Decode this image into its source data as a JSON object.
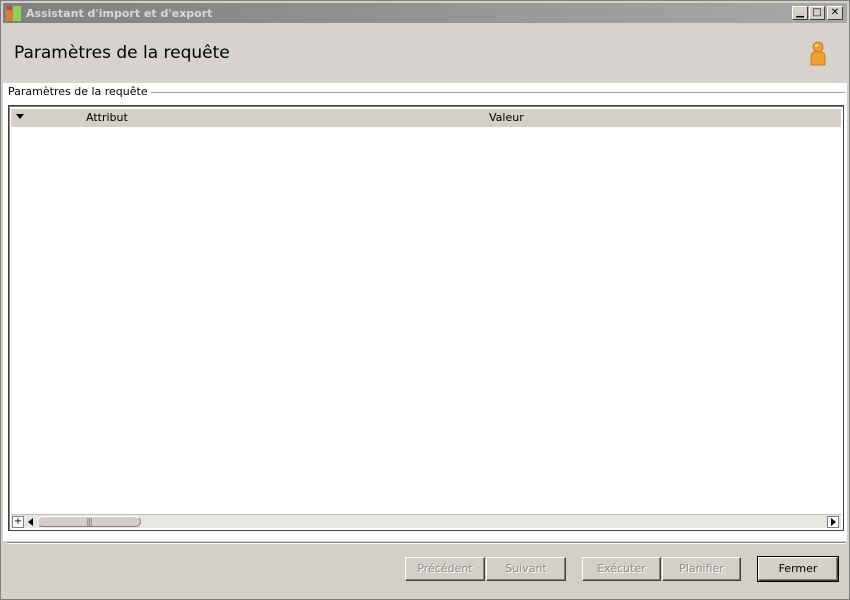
{
  "window": {
    "title": "Assistant d'import et d'export",
    "controls": {
      "minimize": "▁",
      "maximize": "□",
      "close": "✕"
    }
  },
  "header": {
    "title": "Paramètres de la requête",
    "icon": "user-icon"
  },
  "group": {
    "label": "Paramètres de la requête"
  },
  "grid": {
    "columns": [
      "Attribut",
      "Valeur"
    ],
    "rows": [],
    "scroll_thumb_grip": "|||",
    "expand_label": "+"
  },
  "buttons": {
    "previous": "Précédent",
    "next": "Suivant",
    "execute": "Exécuter",
    "schedule": "Planifier",
    "close": "Fermer"
  },
  "colors": {
    "titlebar": "#808080",
    "face": "#d4d0c8",
    "user_icon": "#f0a030"
  }
}
